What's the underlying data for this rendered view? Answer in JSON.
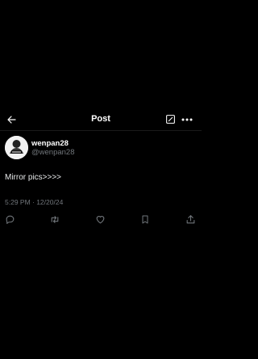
{
  "header": {
    "title": "Post",
    "back_icon": "arrow-left-icon",
    "edit_icon": "edit-square-icon",
    "more_icon": "more-horizontal-icon"
  },
  "author": {
    "display_name": "wenpan28",
    "handle": "@wenpan28",
    "avatar_icon": "avatar"
  },
  "post": {
    "text": "Mirror pics>>>>",
    "timestamp": "5:29 PM · 12/20/24"
  },
  "actions": {
    "reply_icon": "reply-icon",
    "repost_icon": "repost-icon",
    "like_icon": "heart-icon",
    "bookmark_icon": "bookmark-icon",
    "share_icon": "share-icon"
  },
  "colors": {
    "background": "#000000",
    "text": "#e7e9ea",
    "muted": "#71767b"
  }
}
